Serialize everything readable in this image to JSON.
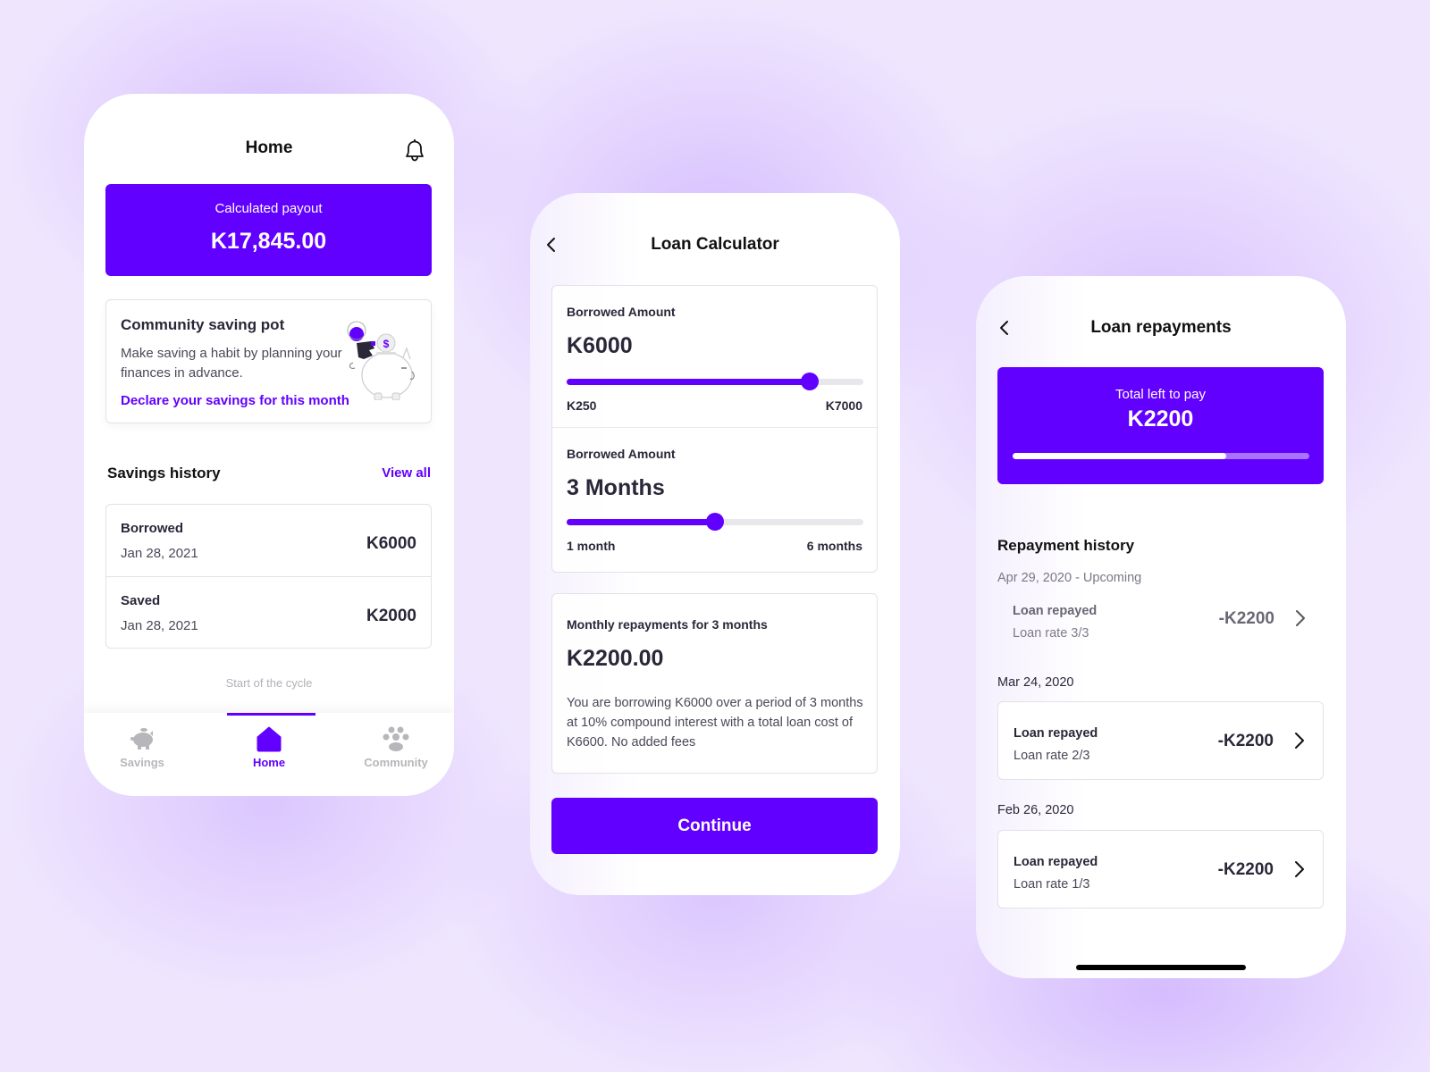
{
  "colors": {
    "accent": "#6200ff",
    "text_dark": "#2a2739",
    "text_muted": "#4a4858",
    "inactive_tab": "#b7b6bb",
    "background": "#efe6fe"
  },
  "home_screen": {
    "title": "Home",
    "notification_icon": "bell-icon",
    "payout": {
      "label": "Calculated payout",
      "value": "K17,845.00"
    },
    "saving_pot": {
      "title": "Community saving pot",
      "description": "Make saving a habit by planning your finances in advance.",
      "link": "Declare your savings for this month",
      "illustration": "piggy-bank-coin-illustration"
    },
    "savings_history": {
      "title": "Savings history",
      "view_all": "View all",
      "items": [
        {
          "type": "Borrowed",
          "date": "Jan 28, 2021",
          "amount": "K6000"
        },
        {
          "type": "Saved",
          "date": "Jan 28, 2021",
          "amount": "K2000"
        }
      ],
      "footer_note": "Start of the cycle"
    },
    "tabbar": {
      "tabs": [
        {
          "label": "Savings",
          "icon": "piggy-bank-icon",
          "active": false
        },
        {
          "label": "Home",
          "icon": "home-icon",
          "active": true
        },
        {
          "label": "Community",
          "icon": "paw-community-icon",
          "active": false
        }
      ]
    }
  },
  "loan_calculator": {
    "title": "Loan Calculator",
    "back_icon": "chevron-left-icon",
    "amount_slider": {
      "label": "Borrowed Amount",
      "value": "K6000",
      "min_label": "K250",
      "max_label": "K7000",
      "fill_fraction": 0.82
    },
    "term_slider": {
      "label": "Borrowed Amount",
      "value": "3 Months",
      "min_label": "1 month",
      "max_label": "6 months",
      "fill_fraction": 0.5
    },
    "repayment": {
      "label": "Monthly repayments for 3 months",
      "value": "K2200.00",
      "description": "You are borrowing K6000 over a period of 3 months at 10% compound interest with a total loan cost of K6600. No added fees"
    },
    "continue_label": "Continue"
  },
  "loan_repayments": {
    "title": "Loan repayments",
    "back_icon": "chevron-left-icon",
    "total": {
      "label": "Total left to pay",
      "value": "K2200",
      "progress_fraction": 0.72
    },
    "history_title": "Repayment history",
    "groups": [
      {
        "date": "Apr 29, 2020 - Upcoming",
        "title": "Loan repayed",
        "subtitle": "Loan rate 3/3",
        "amount": "-K2200",
        "upcoming": true
      },
      {
        "date": "Mar 24, 2020",
        "title": "Loan repayed",
        "subtitle": "Loan rate 2/3",
        "amount": "-K2200",
        "upcoming": false
      },
      {
        "date": "Feb 26, 2020",
        "title": "Loan repayed",
        "subtitle": "Loan rate 1/3",
        "amount": "-K2200",
        "upcoming": false
      }
    ]
  }
}
